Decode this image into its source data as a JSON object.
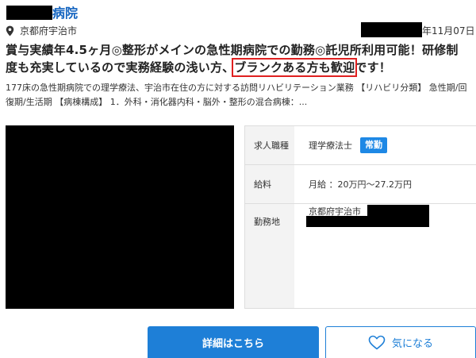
{
  "header": {
    "hospital_name_suffix": "病院",
    "location": "京都府宇治市",
    "post_date": "年11月07日"
  },
  "headline": {
    "before_highlight": "賞与実績年4.5ヶ月◎整形がメインの急性期病院での勤務◎託児所利用可能！研修制度も充実しているので実務経験の浅い方、",
    "highlight": "ブランクある方も歓迎",
    "after_highlight": "です！"
  },
  "description": "177床の急性期病院での理学療法、宇治市在住の方に対する訪問リハビリテーション業務 【リハビリ分類】 急性期/回復期/生活期 【病棟構成】 1．外科・消化器内科・脳外・整形の混合病棟：...",
  "details": {
    "job_type_label": "求人職種",
    "job_type_value": "理学療法士",
    "employment_badge": "常勤",
    "salary_label": "給料",
    "salary_value": "月給 ：20万円〜27.2万円",
    "location_label": "勤務地",
    "location_value": "京都府宇治市"
  },
  "actions": {
    "detail_label": "詳細はこちら",
    "favorite_label": "気になる"
  },
  "colors": {
    "link_blue": "#1565c0",
    "button_blue": "#1e7fd7",
    "badge_blue": "#1e88e5",
    "highlight_red": "#e02020"
  },
  "icons": {
    "location": "map-pin-icon",
    "favorite": "heart-outline-icon"
  }
}
